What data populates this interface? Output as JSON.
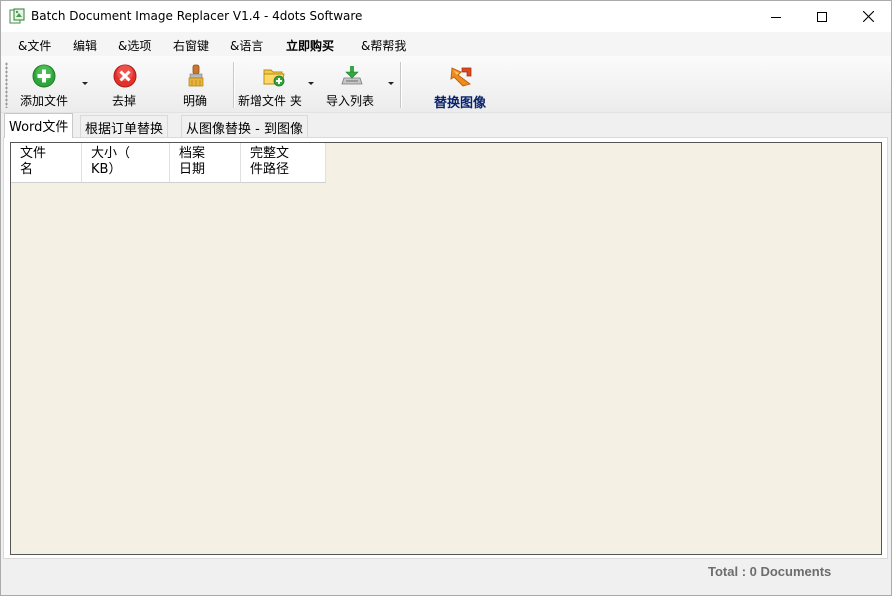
{
  "window": {
    "title": "Batch Document Image Replacer V1.4 - 4dots Software"
  },
  "menu": [
    {
      "label": "&文件",
      "bold": false
    },
    {
      "label": "编辑",
      "bold": false
    },
    {
      "label": "&选项",
      "bold": false
    },
    {
      "label": "右窗键",
      "bold": false
    },
    {
      "label": "&语言",
      "bold": false
    },
    {
      "label": "立即购买",
      "bold": true
    },
    {
      "label": "&帮帮我",
      "bold": false
    }
  ],
  "toolbar": {
    "add_file_label": "添加文件",
    "remove_label": "去掉",
    "clear_label": "明确",
    "new_folder_label": "新增文件 夹",
    "import_list_label": "导入列表",
    "replace_images_label": "替换图像"
  },
  "tabs": [
    {
      "label": "Word文件"
    },
    {
      "label": "根据订单替换"
    },
    {
      "label": "从图像替换 - 到图像"
    }
  ],
  "table": {
    "columns": [
      {
        "label": "文件\n名"
      },
      {
        "label": "大小（\nKB）"
      },
      {
        "label": "档案\n日期"
      },
      {
        "label": "完整文\n件路径"
      }
    ],
    "rows": []
  },
  "status": {
    "total_text": "Total : 0 Documents"
  },
  "colors": {
    "list_background": "#f4f0e4",
    "replace_label": "#0a246a",
    "status_text": "#6d6d6d"
  }
}
